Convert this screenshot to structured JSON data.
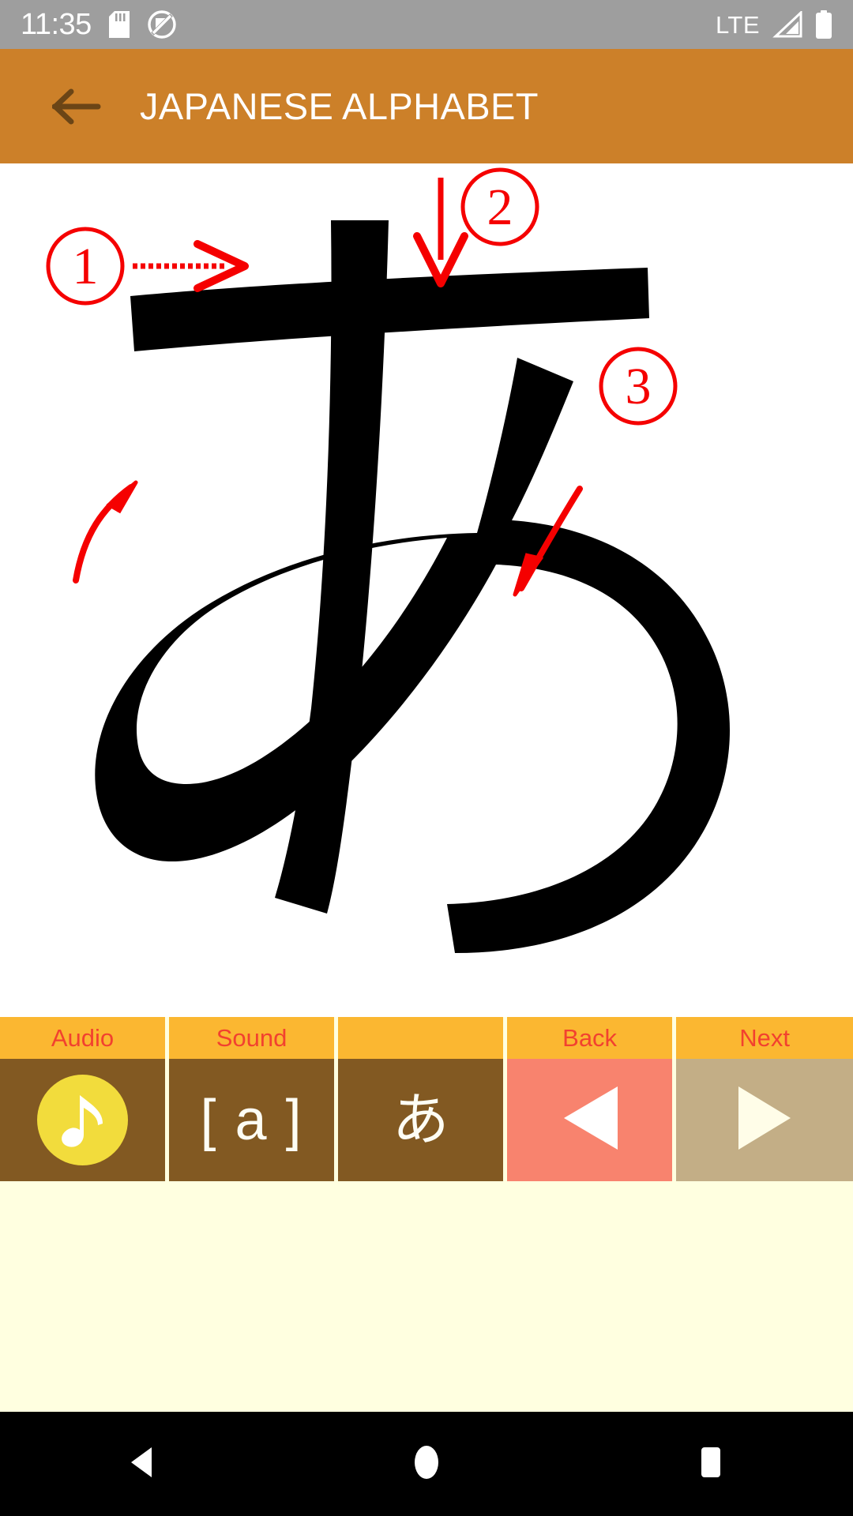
{
  "status_bar": {
    "time": "11:35",
    "network_label": "LTE",
    "icons": [
      "sd-card-icon",
      "do-not-disturb-icon",
      "signal-icon",
      "battery-icon"
    ],
    "background_color": "#9e9e9e",
    "foreground_color": "#ffffff"
  },
  "app_bar": {
    "title": "JAPANESE ALPHABET",
    "back_icon": "back-arrow-icon",
    "background_color": "#cc8029",
    "title_color": "#ffffff",
    "icon_color": "#6b4516"
  },
  "character_view": {
    "character": "あ",
    "romaji": "a",
    "stroke_count": 3,
    "stroke_markers": [
      {
        "number": "1",
        "direction": "right",
        "arrow": "straight-right-arrow"
      },
      {
        "number": "2",
        "direction": "down",
        "arrow": "straight-down-arrow"
      },
      {
        "number": "3",
        "direction": "loop",
        "arrow": "curved-arrow"
      }
    ],
    "stroke_color": "#000000",
    "marker_color": "#f50000",
    "background_color": "#ffffff"
  },
  "control_bar": {
    "header_background": "#fbb731",
    "header_text_color": "#f2412f",
    "divider_color": "#ffffe0",
    "cells": [
      {
        "label": "Audio",
        "icon": "music-note-icon",
        "body_color": "#825922",
        "accent_color": "#f2dc3c"
      },
      {
        "label": "Sound",
        "value": "[ a ]",
        "body_color": "#825922",
        "accent_color": "#fdfdf4"
      },
      {
        "label": "",
        "value": "あ",
        "body_color": "#825922",
        "accent_color": "#fdfdf4"
      },
      {
        "label": "Back",
        "icon": "left-triangle-icon",
        "body_color": "#f8836e",
        "accent_color": "#ffffff"
      },
      {
        "label": "Next",
        "icon": "right-triangle-icon",
        "body_color": "#c3ae86",
        "accent_color": "#fffde8"
      }
    ]
  },
  "page_background": {
    "color": "#ffffe0"
  },
  "nav_bar": {
    "background_color": "#000000",
    "buttons": [
      {
        "name": "back",
        "icon": "nav-back-triangle-icon"
      },
      {
        "name": "home",
        "icon": "nav-home-circle-icon"
      },
      {
        "name": "recents",
        "icon": "nav-recents-square-icon"
      }
    ]
  }
}
